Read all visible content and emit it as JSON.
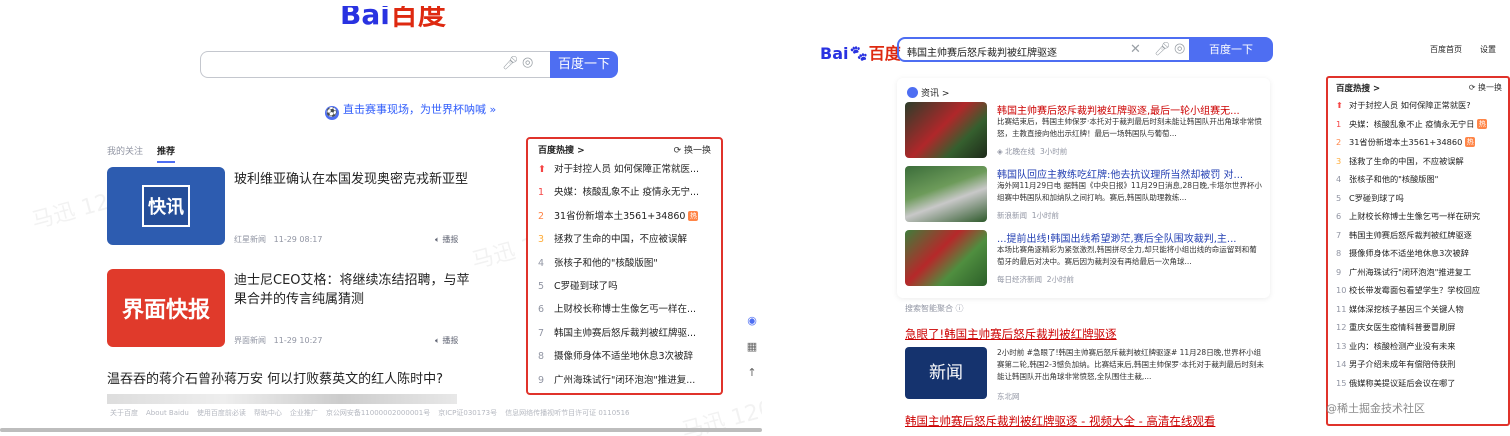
{
  "left": {
    "logo": {
      "part1": "Bai",
      "part2": "百度"
    },
    "search": {
      "value": "",
      "button": "百度一下",
      "mic_icon": "mic-icon",
      "camera_icon": "camera-icon"
    },
    "promo": {
      "text": "直击赛事现场，为世界杯呐喊 »"
    },
    "tabs": [
      "我的关注",
      "推荐"
    ],
    "news": [
      {
        "title": "玻利维亚确认在本国发现奥密克戎新亚型",
        "thumb": "快讯",
        "source": "红星新闻",
        "time": "11-29 08:17",
        "play": "播报"
      },
      {
        "title": "迪士尼CEO艾格：将继续冻结招聘，与苹果合并的传言纯属猜测",
        "thumb": "界面快报",
        "source": "界面新闻",
        "time": "11-29 10:27",
        "play": "播报"
      }
    ],
    "story": "温吞吞的蒋介石曾孙蒋万安 何以打败蔡英文的红人陈时中?",
    "hot": {
      "title": "百度热搜 >",
      "refresh": "换一换",
      "items": [
        {
          "rank": "⬆",
          "text": "对于封控人员 如何保障正常就医..."
        },
        {
          "rank": "1",
          "text": "央媒：核酸乱象不止 疫情永无宁..."
        },
        {
          "rank": "2",
          "text": "31省份新增本土3561+34860",
          "badge": "热"
        },
        {
          "rank": "3",
          "text": "拯救了生命的中国，不应被误解"
        },
        {
          "rank": "4",
          "text": "张核子和他的\"核酸版图\""
        },
        {
          "rank": "5",
          "text": "C罗碰到球了吗"
        },
        {
          "rank": "6",
          "text": "上财校长称博士生像乞丐一样在..."
        },
        {
          "rank": "7",
          "text": "韩国主帅赛后怒斥裁判被红牌驱..."
        },
        {
          "rank": "8",
          "text": "摄像师身体不适坐地休息3次被辞"
        },
        {
          "rank": "9",
          "text": "广州海珠试行\"闭环泡泡\"推进复..."
        }
      ]
    },
    "footer": [
      "关于百度",
      "About Baidu",
      "使用百度前必读",
      "帮助中心",
      "企业推广",
      "京公网安备11000002000001号",
      "京ICP证030173号",
      "信息网络传播视听节目许可证 0110516"
    ]
  },
  "right": {
    "logo": {
      "part1": "Bai",
      "part2": "百度"
    },
    "search": {
      "value": "韩国主帅赛后怒斥裁判被红牌驱逐",
      "button": "百度一下"
    },
    "nav": [
      "百度首页",
      "设置"
    ],
    "news_card": {
      "header": "资讯 >",
      "items": [
        {
          "title": "韩国主帅赛后怒斥裁判被红牌驱逐,最后一轮小组赛无...",
          "summary": "比赛结束后，韩国主帅保罗·本托对于裁判最后时刻未能让韩国队开出角球非常愤怒，主教直接向他出示红牌！最后一场韩国队与葡萄...",
          "source": "北晚在线",
          "time": "3小时前"
        },
        {
          "title": "韩国队回应主教练吃红牌:他去抗议理所当然却被罚 对...",
          "summary": "海外网11月29日电 据韩国《中央日报》11月29日消息,28日晚,卡塔尔世界杯小组赛中韩国队和加纳队之间打响。赛后,韩国队助理教练...",
          "source": "新浪新闻",
          "time": "1小时前"
        },
        {
          "title": "...提前出线!韩国出线希望渺茫,赛后全队围攻裁判,主...",
          "summary": "本场比赛角逐精彩为紧张激烈,韩国拼尽全力,却只能将小组出线的命运留到和葡萄牙的最后对决中。赛后因为裁判没有再给最后一次角球...",
          "source": "每日经济新闻",
          "time": "2小时前"
        }
      ]
    },
    "aggregate": "搜索智能聚合",
    "result2": {
      "title": "急眼了!韩国主帅赛后怒斥裁判被红牌驱逐",
      "thumb": "新闻",
      "summary": "2小时前 #急眼了!韩国主帅赛后怒斥裁判被红牌驱逐# 11月28日晚,世界杯小组赛第二轮,韩国2-3憾负加纳。比赛结束后,韩国主帅保罗·本托对于裁判最后时刻未能让韩国队开出角球非常愤怒,全队围住主裁,...",
      "source": "东北网"
    },
    "result3": {
      "title": "韩国主帅赛后怒斥裁判被红牌驱逐 - 视频大全 - 高清在线观看"
    },
    "hot": {
      "title": "百度热搜 >",
      "refresh": "换一换",
      "items": [
        {
          "rank": "⬆",
          "text": "对于封控人员 如何保障正常就医?"
        },
        {
          "rank": "1",
          "text": "央媒：核酸乱象不止 疫情永无宁日",
          "badge": "热"
        },
        {
          "rank": "2",
          "text": "31省份新增本土3561+34860",
          "badge": "热"
        },
        {
          "rank": "3",
          "text": "拯救了生命的中国，不应被误解"
        },
        {
          "rank": "4",
          "text": "张核子和他的\"核酸版图\""
        },
        {
          "rank": "5",
          "text": "C罗碰到球了吗"
        },
        {
          "rank": "6",
          "text": "上财校长称博士生像乞丐一样在研究"
        },
        {
          "rank": "7",
          "text": "韩国主帅赛后怒斥裁判被红牌驱逐"
        },
        {
          "rank": "8",
          "text": "摄像师身体不适坐地休息3次被辞"
        },
        {
          "rank": "9",
          "text": "广州海珠试行\"闭环泡泡\"推进复工"
        },
        {
          "rank": "10",
          "text": "校长带发霉面包看望学生？学校回应"
        },
        {
          "rank": "11",
          "text": "媒体深挖核子基因三个关键人物"
        },
        {
          "rank": "12",
          "text": "重庆女医生疫情科普要冒刷屏"
        },
        {
          "rank": "13",
          "text": "业内：核酸检测产业没有未来"
        },
        {
          "rank": "14",
          "text": "男子介绍未成年有偿陪侍获刑"
        },
        {
          "rank": "15",
          "text": "俄媒称美提议延后会议在哪了"
        }
      ]
    },
    "watermark": "@稀土掘金技术社区"
  },
  "watermarks": [
    "马迅 1202",
    "马迅 1202",
    "马迅 1202"
  ]
}
